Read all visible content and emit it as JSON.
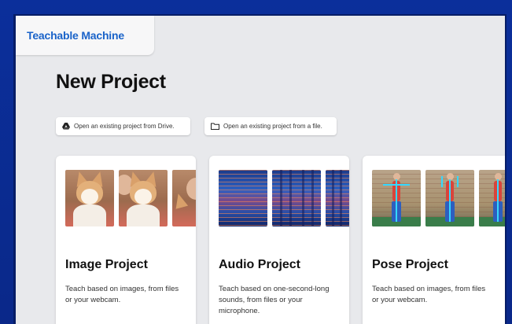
{
  "app": {
    "brand": "Teachable Machine"
  },
  "page": {
    "title": "New Project"
  },
  "actions": {
    "drive_label": "Open an existing project from Drive.",
    "file_label": "Open an existing project from a file."
  },
  "cards": [
    {
      "title": "Image Project",
      "description": "Teach based on images, from files or your webcam."
    },
    {
      "title": "Audio Project",
      "description": "Teach based on one-second-long sounds, from files or your microphone."
    },
    {
      "title": "Pose Project",
      "description": "Teach based on images, from files or your webcam."
    }
  ],
  "colors": {
    "frame": "#0a2a8f",
    "brand_text": "#1a63c9",
    "page_bg": "#e8e9ec"
  },
  "icons": [
    "google-drive-icon",
    "folder-icon"
  ]
}
